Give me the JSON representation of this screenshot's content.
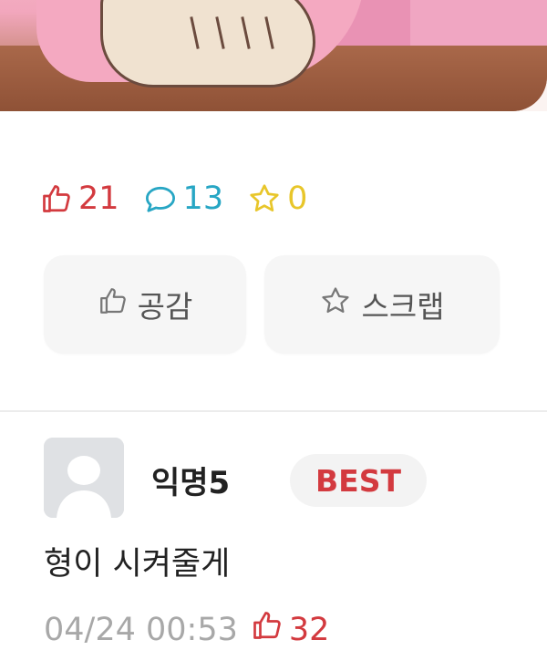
{
  "stats": {
    "likes": "21",
    "comments": "13",
    "scraps": "0"
  },
  "actions": {
    "like_label": "공감",
    "scrap_label": "스크랩"
  },
  "comment": {
    "author": "익명5",
    "badge": "BEST",
    "text": "형이 시켜줄게",
    "timestamp": "04/24 00:53",
    "likes": "32"
  },
  "colors": {
    "like": "#d33a3f",
    "comment": "#27a6c4",
    "scrap": "#e8c62a"
  },
  "icons": [
    "thumbs-up-icon",
    "comment-bubble-icon",
    "star-icon",
    "avatar-placeholder-icon"
  ]
}
